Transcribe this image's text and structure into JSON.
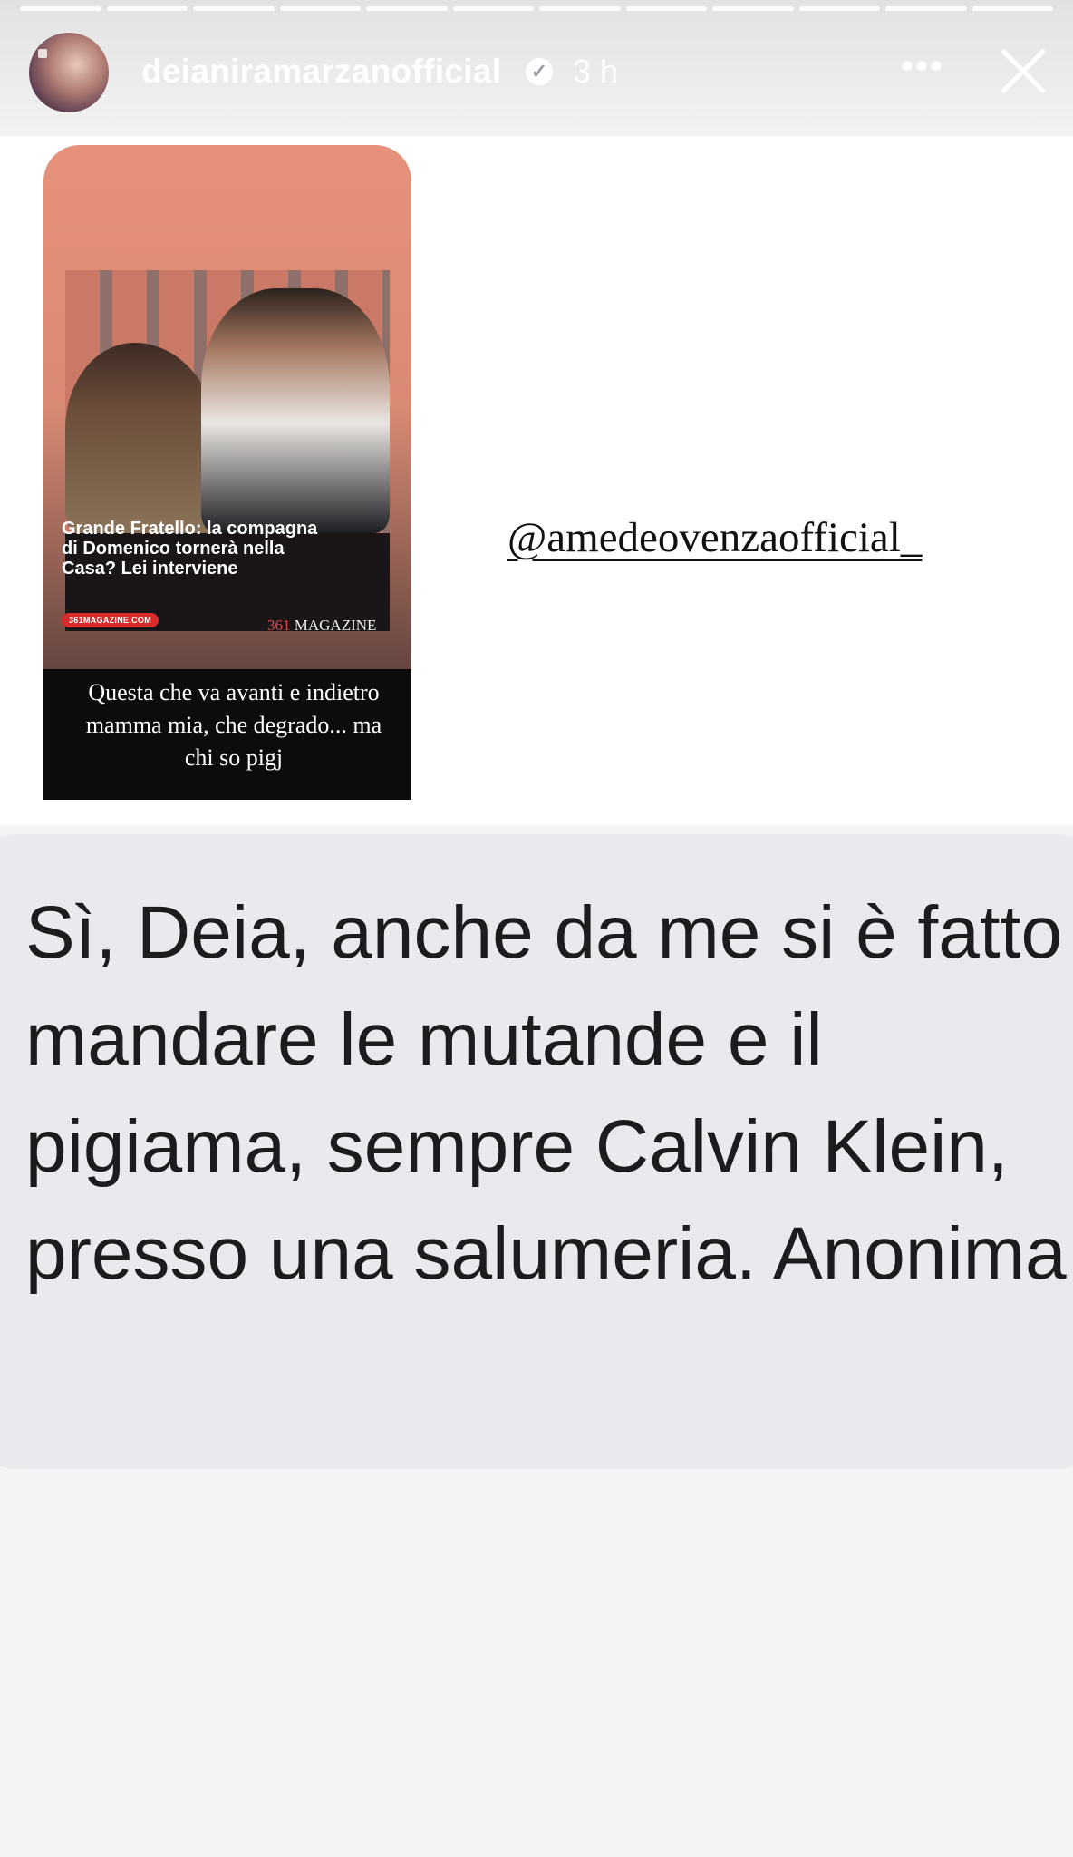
{
  "story": {
    "progress_segments": 12,
    "header": {
      "username": "deianiramarzanofficial",
      "verified_icon": "✓",
      "time": "3 h",
      "more_icon": "•••"
    },
    "shared_post": {
      "headline": "Grande Fratello: la compagna di Domenico tornerà nella Casa? Lei interviene",
      "site_badge": "361MAGAZINE.COM",
      "logo_number": "361",
      "logo_word": "MAGAZINE",
      "caption": "Questa che va avanti e indietro\nmamma mia, che degrado... ma\nchi so pigj"
    },
    "mention": "@amedeovenzaofficial_",
    "message": "Sì, Deia, anche da me si è fatto mandare le mutande e il pigiama, sempre Calvin Klein, presso una salumeria. Anonima"
  }
}
